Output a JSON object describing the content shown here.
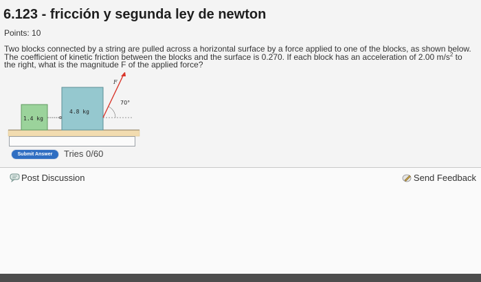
{
  "problem": {
    "title": "6.123 - fricción y segunda ley de newton",
    "points_label": "Points: 10",
    "text_part1": "Two blocks connected by a string are pulled across a horizontal surface by a force applied to one of the blocks, as shown below. The coefficient of kinetic friction between the blocks and the surface is 0.270. If each block has an acceleration of 2.00 m/s",
    "text_sup": "2",
    "text_part2": " to the right, what is the magnitude F of the applied force?"
  },
  "figure": {
    "small_block_label": "1.4 kg",
    "large_block_label": "4.8 kg",
    "force_label": "F",
    "angle_label": "70°",
    "small_block_color": "#9bd39b",
    "large_block_color": "#95c8cf",
    "ground_color": "#f2dcb0",
    "force_color": "#d9362b"
  },
  "answer": {
    "input_value": "",
    "submit_label": "Submit Answer",
    "tries_label": "Tries 0/60"
  },
  "footer": {
    "post_discussion_label": "Post Discussion",
    "send_feedback_label": "Send Feedback"
  },
  "icons": {
    "discussion": "speech-bubble-icon",
    "feedback": "pencil-feedback-icon"
  }
}
